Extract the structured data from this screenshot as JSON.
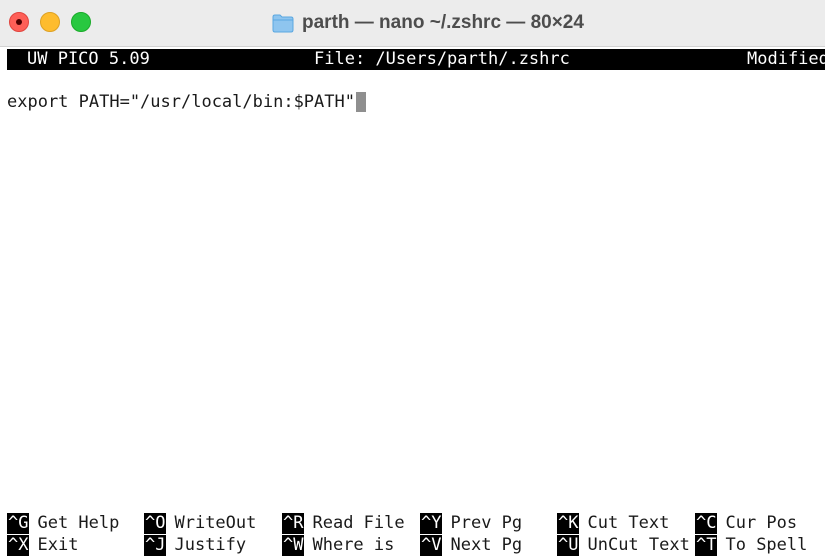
{
  "window": {
    "title": "parth — nano ~/.zshrc — 80×24"
  },
  "header": {
    "app_version": "UW PICO 5.09",
    "file": "File: /Users/parth/.zshrc",
    "status": "Modified"
  },
  "editor": {
    "line1": "export PATH=\"/usr/local/bin:$PATH\""
  },
  "shortcuts": {
    "row1": [
      {
        "key": "^G",
        "label": "Get Help"
      },
      {
        "key": "^O",
        "label": "WriteOut"
      },
      {
        "key": "^R",
        "label": "Read File"
      },
      {
        "key": "^Y",
        "label": "Prev Pg"
      },
      {
        "key": "^K",
        "label": "Cut Text"
      },
      {
        "key": "^C",
        "label": "Cur Pos"
      }
    ],
    "row2": [
      {
        "key": "^X",
        "label": "Exit"
      },
      {
        "key": "^J",
        "label": "Justify"
      },
      {
        "key": "^W",
        "label": "Where is"
      },
      {
        "key": "^V",
        "label": "Next Pg"
      },
      {
        "key": "^U",
        "label": "UnCut Text"
      },
      {
        "key": "^T",
        "label": "To Spell"
      }
    ]
  },
  "colors": {
    "close": "#fe5f57",
    "minimize": "#febc2e",
    "maximize": "#28c840",
    "header_bg": "#000000",
    "cursor": "#8f8f8f"
  }
}
